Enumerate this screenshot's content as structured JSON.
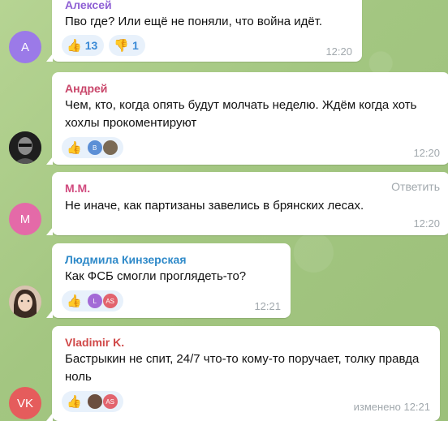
{
  "messages": [
    {
      "author": "Алексей",
      "text": "Пво где? Или ещё не поняли, что война идёт.",
      "time": "12:20",
      "avatar_letter": "А",
      "reactions": [
        {
          "emoji": "👍",
          "count": "13"
        },
        {
          "emoji": "👎",
          "count": "1"
        }
      ]
    },
    {
      "author": "Андрей",
      "text": "Чем, кто, когда опять будут молчать неделю. Ждём когда хоть хохлы прокоментируют",
      "time": "12:20",
      "reaction_emoji": "👍",
      "reactor_letters": [
        "В",
        ""
      ]
    },
    {
      "author": "М.М.",
      "text": "Не иначе, как партизаны завелись в брянских лесах.",
      "time": "12:20",
      "avatar_letter": "М",
      "reply_label": "Ответить"
    },
    {
      "author": "Людмила Кинзерская",
      "text": "Как ФСБ смогли проглядеть-то?",
      "time": "12:21",
      "reaction_emoji": "👍",
      "reactor_letters": [
        "L",
        "AS"
      ]
    },
    {
      "author": "Vladimir K.",
      "text": "Бастрыкин не спит, 24/7 что-то кому-то поручает, толку правда ноль",
      "time": "изменено 12:21",
      "avatar_letter": "VK",
      "reaction_emoji": "👍",
      "reactor_letters": [
        "",
        "AS"
      ]
    }
  ],
  "colors": {
    "alexey": "#8e5fd4",
    "andrey": "#c9466a",
    "mm": "#d14b7f",
    "lyudmila": "#2f8ac9",
    "vladimir": "#d04848",
    "avatar_alexey": "#9b7ae8",
    "avatar_mm": "#e46aa8",
    "avatar_vk": "#e55c5c"
  }
}
